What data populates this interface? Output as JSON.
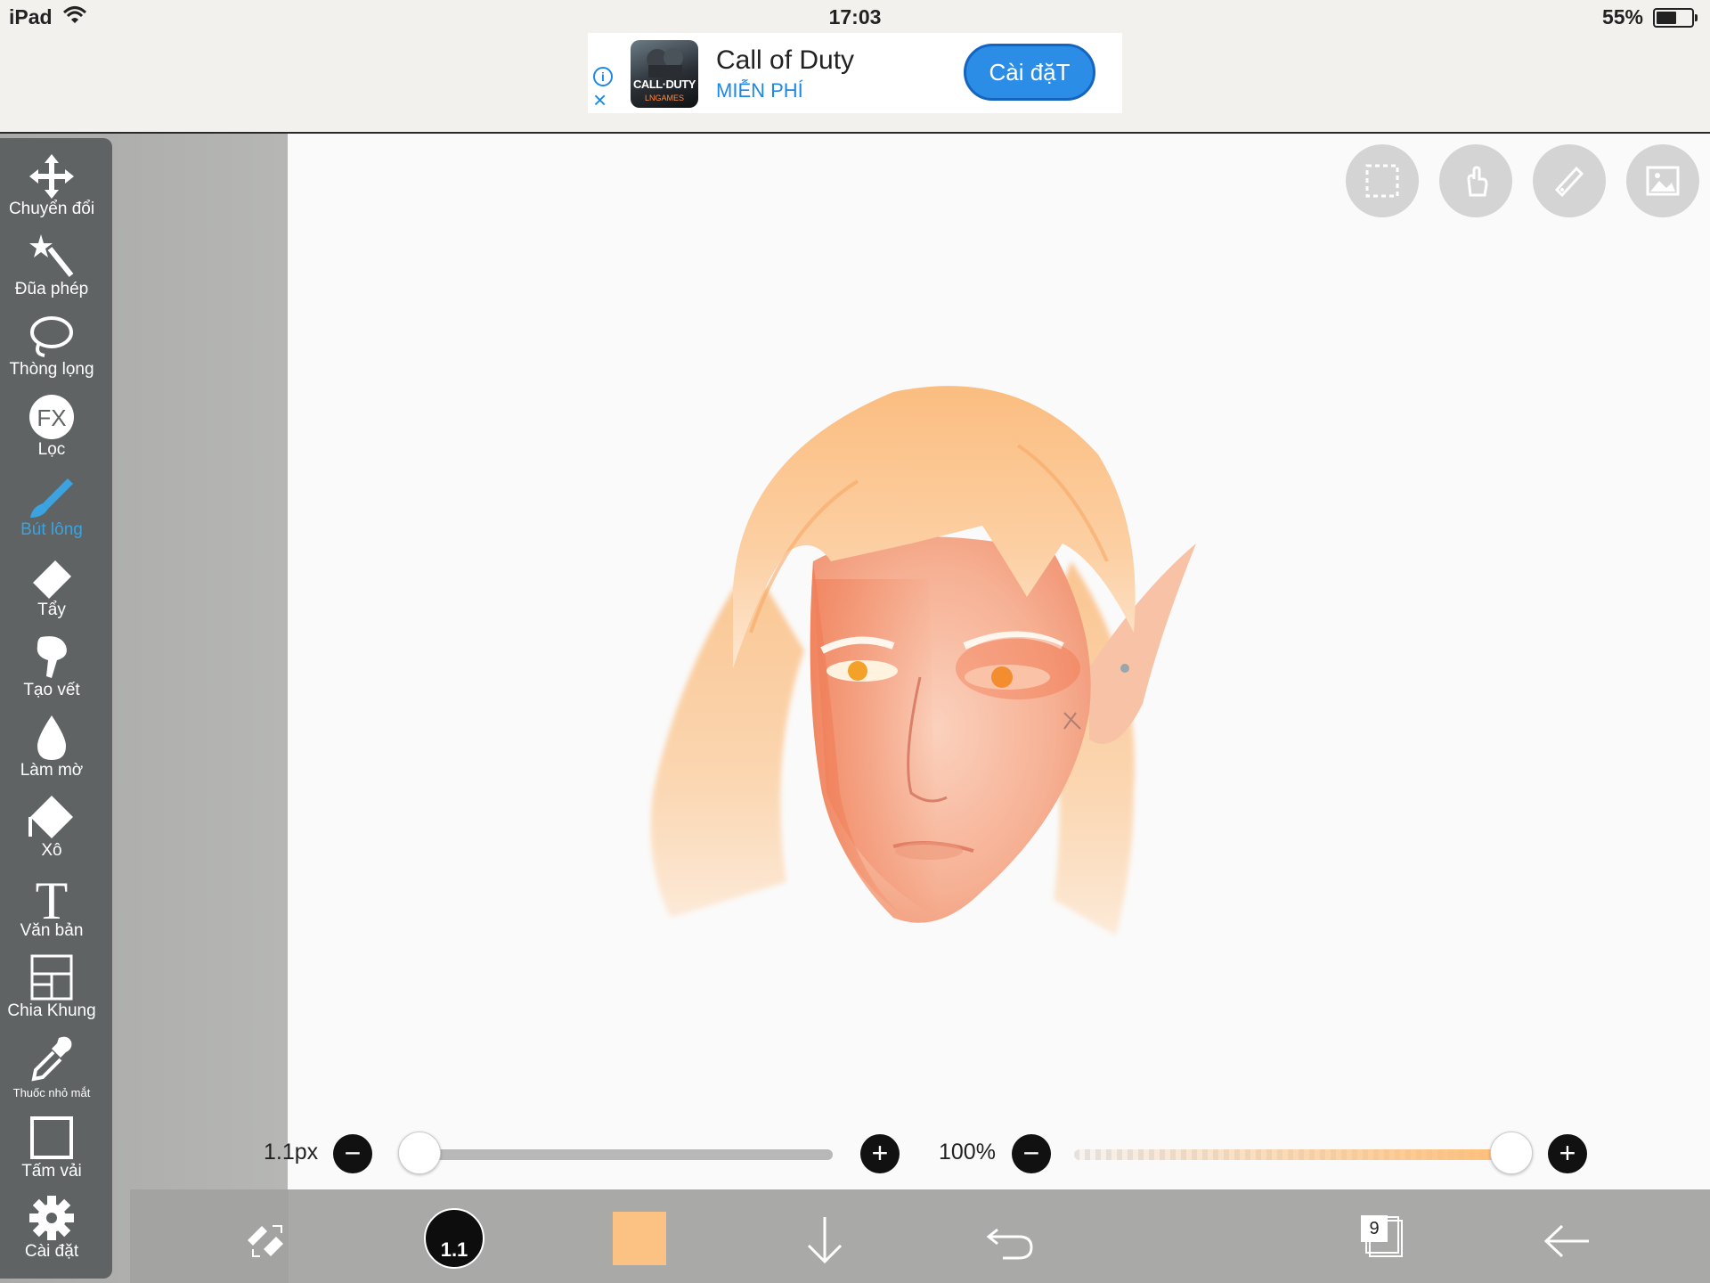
{
  "status": {
    "device": "iPad",
    "time": "17:03",
    "battery": "55%"
  },
  "ad": {
    "title": "Call of Duty",
    "subtitle": "MIỄN PHÍ",
    "button": "Cài đặT",
    "icon_text": "CALL·DUTY",
    "icon_publisher": "LNGAMES"
  },
  "tools": [
    {
      "label": "Chuyển đổi",
      "icon": "move-icon"
    },
    {
      "label": "Đũa phép",
      "icon": "magic-wand-icon"
    },
    {
      "label": "Thòng lọng",
      "icon": "lasso-icon"
    },
    {
      "label": "Lọc",
      "icon": "fx-icon",
      "icon_text": "FX"
    },
    {
      "label": "Bút lông",
      "icon": "brush-icon",
      "active": true
    },
    {
      "label": "Tẩy",
      "icon": "eraser-icon"
    },
    {
      "label": "Tạo vết",
      "icon": "smudge-icon"
    },
    {
      "label": "Làm mờ",
      "icon": "blur-icon"
    },
    {
      "label": "Xô",
      "icon": "bucket-icon"
    },
    {
      "label": "Văn bản",
      "icon": "text-icon",
      "icon_text": "T"
    },
    {
      "label": "Chia Khung",
      "icon": "frame-divider-icon"
    },
    {
      "label": "Thuốc nhỏ mắt",
      "icon": "eyedropper-icon"
    },
    {
      "label": "Tấm vải",
      "icon": "canvas-icon"
    },
    {
      "label": "Cài đặt",
      "icon": "gear-icon"
    }
  ],
  "top_buttons": [
    "selection-icon",
    "hand-icon",
    "ruler-icon",
    "image-icon"
  ],
  "brush": {
    "size_label": "1.1px",
    "size_fraction": 0.0,
    "opacity_label": "100%",
    "opacity_fraction": 1.0,
    "circle_text": "1.1"
  },
  "colors": {
    "current": "#fcc283",
    "accent": "#3aa3e0",
    "toolbar": "#5f6364"
  },
  "layers": {
    "count": "9"
  }
}
